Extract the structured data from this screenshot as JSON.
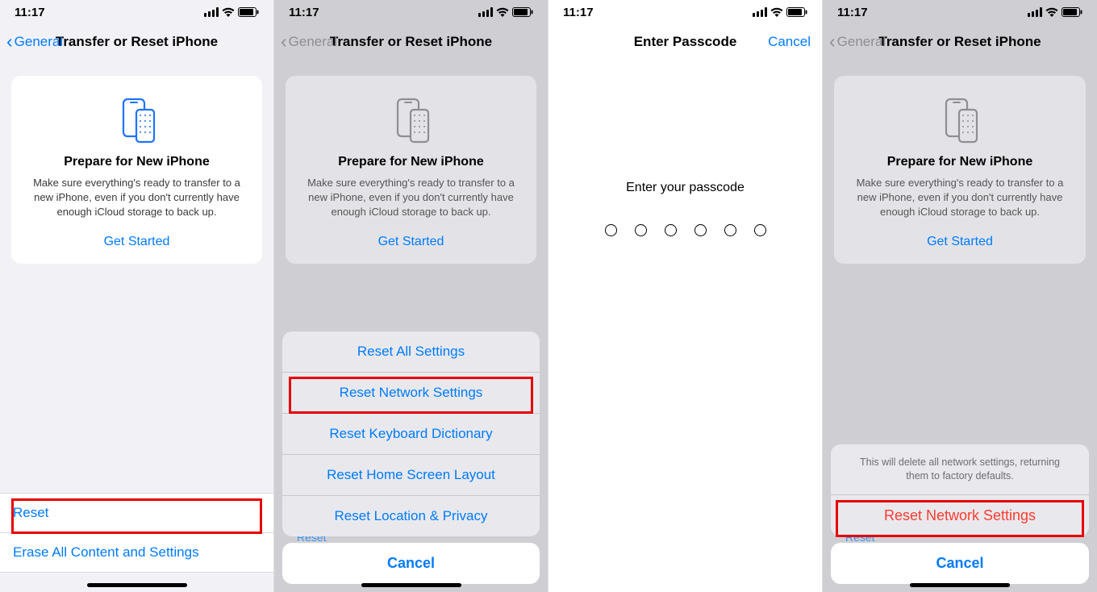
{
  "status": {
    "time": "11:17"
  },
  "nav": {
    "back": "General",
    "title": "Transfer or Reset iPhone"
  },
  "card": {
    "title": "Prepare for New iPhone",
    "body": "Make sure everything's ready to transfer to a new iPhone, even if you don't currently have enough iCloud storage to back up.",
    "cta": "Get Started"
  },
  "screen1_rows": {
    "reset": "Reset",
    "erase": "Erase All Content and Settings"
  },
  "reset_sheet": {
    "items": [
      "Reset All Settings",
      "Reset Network Settings",
      "Reset Keyboard Dictionary",
      "Reset Home Screen Layout",
      "Reset Location & Privacy"
    ],
    "cancel": "Cancel",
    "peek": "Reset"
  },
  "passcode": {
    "title": "Enter Passcode",
    "cancel": "Cancel",
    "prompt": "Enter your passcode"
  },
  "confirm_sheet": {
    "msg": "This will delete all network settings, returning them to factory defaults.",
    "action": "Reset Network Settings",
    "cancel": "Cancel",
    "peek": "Reset"
  }
}
